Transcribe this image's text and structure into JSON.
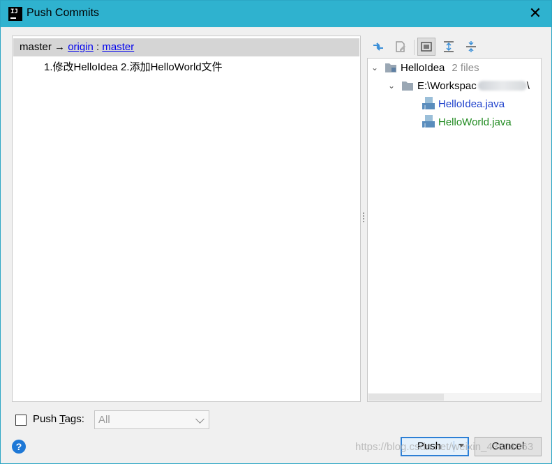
{
  "window": {
    "title": "Push Commits",
    "logo_text": "IJ",
    "close_glyph": "✕",
    "accent_color": "#2fb2cf"
  },
  "left": {
    "branch": {
      "local": "master",
      "arrow": " → ",
      "remote": "origin",
      "separator": " : ",
      "remote_branch": "master"
    },
    "commits": [
      {
        "message": "1.修改HelloIdea 2.添加HelloWorld文件"
      }
    ]
  },
  "toolbar": {
    "icons": [
      "diff-icon",
      "edit-source-icon",
      "group-by-directory-icon",
      "expand-all-icon",
      "collapse-all-icon"
    ]
  },
  "tree": {
    "project": {
      "name": "HelloIdea",
      "count": "2 files"
    },
    "path": "E:\\Workspac",
    "path_tail": "\\",
    "files": [
      {
        "name": "HelloIdea.java",
        "status": "modified",
        "color": "#1c3fcb"
      },
      {
        "name": "HelloWorld.java",
        "status": "added",
        "color": "#1f8a1f"
      }
    ]
  },
  "bottom": {
    "push_tags": {
      "label_pre": "Push ",
      "label_mnemonic": "T",
      "label_post": "ags:",
      "checked": false
    },
    "tags_select": {
      "value": "All"
    },
    "help_glyph": "?",
    "push_label": "Push",
    "cancel_label": "Cancel"
  },
  "watermark": "https://blog.csdn.net/weixin_43801363"
}
